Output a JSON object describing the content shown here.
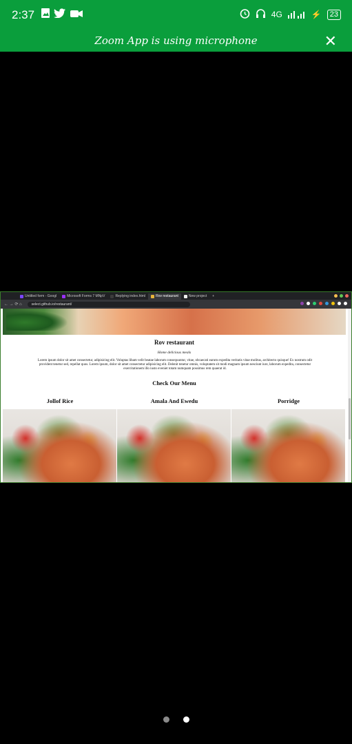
{
  "status": {
    "time": "2:37",
    "network": "4G",
    "battery": "23"
  },
  "zoom": {
    "message": "Zoom App is using microphone"
  },
  "browser": {
    "tabs": [
      {
        "label": "Untitled form - Googl",
        "active": false,
        "color": "#7b45ff"
      },
      {
        "label": "Microsoft Forms 7 MNpV",
        "active": false,
        "color": "#9b30ff"
      },
      {
        "label": "Replying index.html",
        "active": false,
        "color": "#3b3b3b"
      },
      {
        "label": "Rov restaurant",
        "active": true,
        "color": "#e8b53a"
      },
      {
        "label": "New project",
        "active": false,
        "color": "#eeeeee"
      }
    ],
    "new_tab": "+",
    "url": "select.github.io/restaurant/"
  },
  "site": {
    "title": "Rov restaurant",
    "tagline": "Home delicious meals",
    "body": "Lorem ipsum dolor sit amet consectetur, adipisicing elit. Voluptas libam velit beatae laborum consequuntur, vitae, obcaecati earum expedita veritatis vitae molitus, architecto quisque! Ex nostrum odit provident tenetur sed, repellat quos. Lorem ipsum, dolor sit amet consectetur adipisicing elit. Delenit tenetur omnis, voluptatem sit modi magnam ipsum nesciunt iure, laborum expedita, consectetur exercitationem illo iusto eveniet totam numquam possimus rem quaerat id.",
    "menu_heading": "Check Our Menu",
    "dishes": [
      "Jollof Rice",
      "Amala And Ewedu",
      "Porridge"
    ]
  },
  "colors": {
    "bar_green": "#0a9e3c"
  }
}
